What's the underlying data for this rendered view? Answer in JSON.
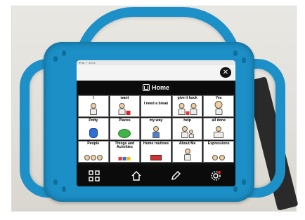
{
  "status_bar": {
    "text": "iPad ⌔  10:21"
  },
  "top_bar": {
    "backspace_icon": "backspace-x-icon"
  },
  "title": {
    "text": "Home",
    "icon": "home-icon"
  },
  "grid": {
    "cells": [
      {
        "label": "I",
        "icon": "person-pointing-self-icon"
      },
      {
        "label": "want",
        "icon": "person-reaching-icon"
      },
      {
        "label": "I need a break",
        "icon": "break-icon"
      },
      {
        "label": "give it back",
        "icon": "give-back-icon"
      },
      {
        "label": "Yes",
        "icon": "yes-nod-icon"
      },
      {
        "label": "Potty",
        "icon": "toilet-icon"
      },
      {
        "label": "Places",
        "icon": "places-icon"
      },
      {
        "label": "my way",
        "icon": "my-way-icon"
      },
      {
        "label": "help",
        "icon": "help-icon"
      },
      {
        "label": "all done",
        "icon": "all-done-icon"
      },
      {
        "label": "People",
        "icon": "people-group-icon"
      },
      {
        "label": "Things and Activities",
        "icon": "toys-icon"
      },
      {
        "label": "Home routines",
        "icon": "home-routines-icon"
      },
      {
        "label": "About Me",
        "icon": "about-me-icon"
      },
      {
        "label": "Expressions",
        "icon": "expressions-faces-icon"
      }
    ]
  },
  "bottom_bar": {
    "icons": [
      "grid-apps-icon",
      "home-outline-icon",
      "pencil-icon",
      "gear-icon"
    ]
  },
  "colors": {
    "case_blue": "#1d90c8",
    "screen_black": "#0b0b0b",
    "cell_white": "#ffffff"
  }
}
